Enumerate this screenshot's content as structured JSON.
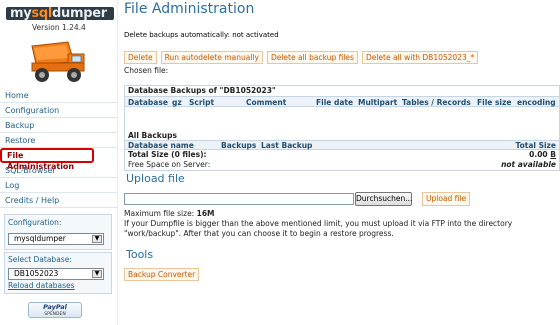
{
  "app": {
    "logo_text": "mysqldumper",
    "logo_sub": "MYSQLDUMPER",
    "version": "Version 1.24.4"
  },
  "sidebar": {
    "items": [
      {
        "label": "Home"
      },
      {
        "label": "Configuration"
      },
      {
        "label": "Backup"
      },
      {
        "label": "Restore"
      },
      {
        "label": "File Administration",
        "active": true
      },
      {
        "label": "SQL-Browser"
      },
      {
        "label": "Log"
      },
      {
        "label": "Credits / Help"
      }
    ],
    "config_label": "Configuration:",
    "config_value": "mysqldumper",
    "db_label": "Select Database:",
    "db_value": "DB1052023",
    "reload_label": "Reload databases",
    "paypal_label": "PayPal",
    "paypal_sub": "SPENDEN"
  },
  "main": {
    "title": "File Administration",
    "auto_note": "Delete backups automatically: not activated",
    "buttons": {
      "delete": "Delete",
      "run_autodelete": "Run autodelete manually",
      "delete_all": "Delete all backup files",
      "delete_all_with": "Delete all with DB1052023_*"
    },
    "chosen_file": "Chosen file:",
    "db_backups_title": "Database Backups of \"DB1052023\"",
    "columns": [
      "Database",
      "gz",
      "Script",
      "Comment",
      "File date",
      "Multipart",
      "Tables / Records",
      "File size",
      "encoding"
    ],
    "all_backups_title": "All Backups",
    "all_columns": [
      "Database name",
      "Backups",
      "Last Backup",
      "Total Size"
    ],
    "total_size_label": "Total Size (0 files):",
    "total_size_value": "0.00",
    "total_size_unit": "B",
    "free_space_label": "Free Space on Server:",
    "free_space_value": "not available"
  },
  "upload": {
    "title": "Upload file",
    "browse_label": "Durchsuchen...",
    "upload_label": "Upload file",
    "max_size_label": "Maximum file size:",
    "max_size_value": "16M",
    "note": "If your Dumpfile is bigger than the above mentioned limit, you must upload it via FTP into the directory \"work/backup\". After that you can choose it to begin a restore progress."
  },
  "tools": {
    "title": "Tools",
    "converter_label": "Backup Converter"
  },
  "colors": {
    "accent_blue": "#2d6e9e",
    "button_orange": "#c85a00",
    "active_red": "#d40000"
  }
}
